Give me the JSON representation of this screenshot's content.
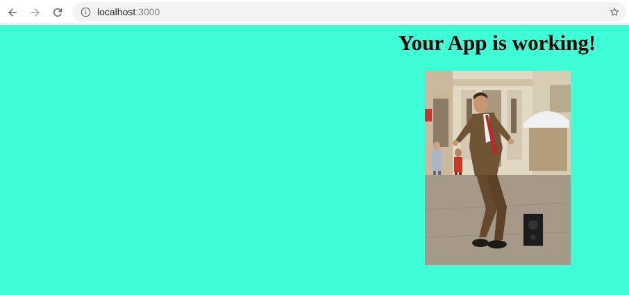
{
  "browser": {
    "url_host": "localhost",
    "url_port": ":3000"
  },
  "page": {
    "background_color": "#3dfed5",
    "heading": "Your App is working!",
    "image": {
      "alt": "Animated GIF of a man in a brown suit dancing on a street next to a speaker"
    }
  }
}
